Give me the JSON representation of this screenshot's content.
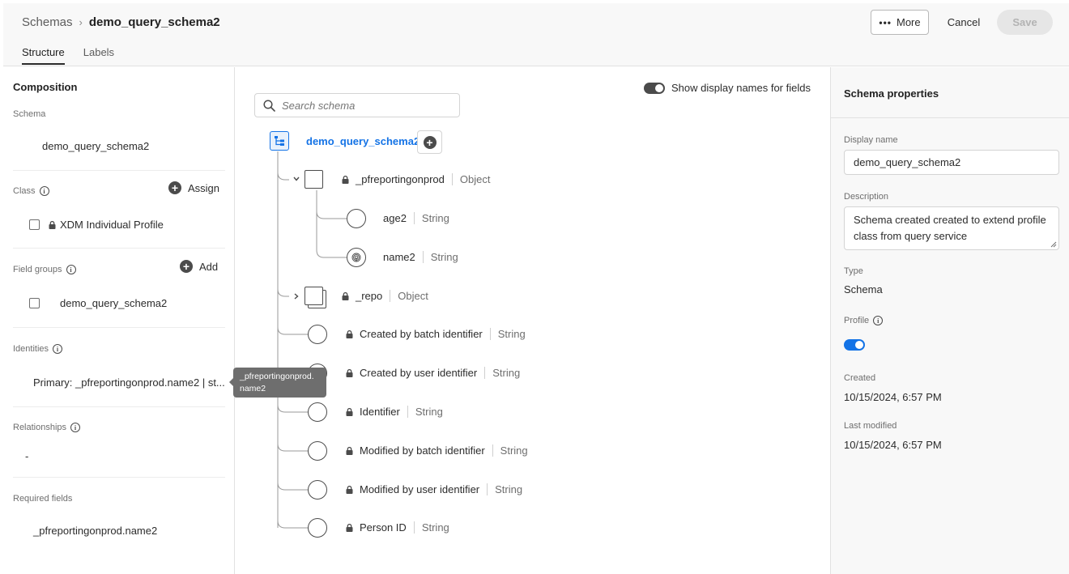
{
  "header": {
    "breadcrumb_root": "Schemas",
    "breadcrumb_separator": "›",
    "breadcrumb_current": "demo_query_schema2",
    "tabs": [
      {
        "label": "Structure",
        "active": true
      },
      {
        "label": "Labels",
        "active": false
      }
    ],
    "more_icon": "more-dots-icon",
    "more_label": "More",
    "cancel_label": "Cancel",
    "save_label": "Save"
  },
  "composition": {
    "title": "Composition",
    "schema_label": "Schema",
    "schema_value": "demo_query_schema2",
    "class_label": "Class",
    "class_action": "Assign",
    "class_item": "XDM Individual Profile",
    "field_groups_label": "Field groups",
    "field_groups_action": "Add",
    "field_group_item": "demo_query_schema2",
    "identities_label": "Identities",
    "identities_value": "Primary: _pfreportingonprod.name2 | st...",
    "relationships_label": "Relationships",
    "relationships_value": "-",
    "required_fields_label": "Required fields",
    "required_fields_value": "_pfreportingonprod.name2"
  },
  "tooltip": {
    "line1": "_pfreportingonprod.",
    "line2": "name2"
  },
  "tree": {
    "search_placeholder": "Search schema",
    "show_display_names_label": "Show display names for fields",
    "show_display_names_on": true,
    "root_name": "demo_query_schema2",
    "nodes": [
      {
        "name": "_pfreportingonprod",
        "type": "Object",
        "locked": true,
        "expanded": true
      },
      {
        "name": "age2",
        "type": "String",
        "locked": false
      },
      {
        "name": "name2",
        "type": "String",
        "locked": false,
        "icon": "fingerprint-icon"
      },
      {
        "name": "_repo",
        "type": "Object",
        "locked": true,
        "expanded": false
      },
      {
        "name": "Created by batch identifier",
        "type": "String",
        "locked": true
      },
      {
        "name": "Created by user identifier",
        "type": "String",
        "locked": true
      },
      {
        "name": "Identifier",
        "type": "String",
        "locked": true
      },
      {
        "name": "Modified by batch identifier",
        "type": "String",
        "locked": true
      },
      {
        "name": "Modified by user identifier",
        "type": "String",
        "locked": true
      },
      {
        "name": "Person ID",
        "type": "String",
        "locked": true
      }
    ]
  },
  "properties": {
    "title": "Schema properties",
    "display_name_label": "Display name",
    "display_name_value": "demo_query_schema2",
    "description_label": "Description",
    "description_value": "Schema created created to extend profile class from query service",
    "type_label": "Type",
    "type_value": "Schema",
    "profile_label": "Profile",
    "profile_enabled": true,
    "created_label": "Created",
    "created_value": "10/15/2024, 6:57 PM",
    "last_modified_label": "Last modified",
    "last_modified_value": "10/15/2024, 6:57 PM"
  },
  "colors": {
    "accent": "#1473e6",
    "toggle_dark": "#4b4b4b"
  }
}
